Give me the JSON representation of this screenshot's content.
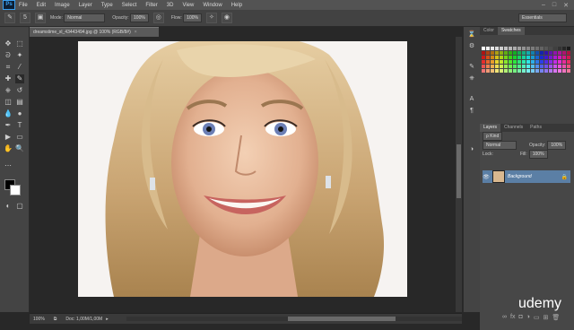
{
  "app": {
    "logo": "Ps"
  },
  "menu": [
    "File",
    "Edit",
    "Image",
    "Layer",
    "Type",
    "Select",
    "Filter",
    "3D",
    "View",
    "Window",
    "Help"
  ],
  "window_controls": [
    "–",
    "□",
    "✕"
  ],
  "options_bar": {
    "brush_size": "5",
    "mode_label": "Mode:",
    "mode_value": "Normal",
    "opacity_label": "Opacity:",
    "opacity_value": "100%",
    "flow_label": "Flow:",
    "flow_value": "100%",
    "workspace": "Essentials"
  },
  "document": {
    "tab_title": "dreamstime_xl_43443494.jpg @ 100% (RGB/8#)",
    "close": "×",
    "zoom": "100%",
    "doc_size": "Doc: 1,00M/1,00M"
  },
  "right_panel": {
    "color_tabs": [
      "Color",
      "Swatches"
    ],
    "layers_tabs": [
      "Layers",
      "Channels",
      "Paths"
    ],
    "kind_label": "ρ Kind",
    "blend_mode": "Normal",
    "opacity_label": "Opacity:",
    "opacity_value": "100%",
    "lock_label": "Lock:",
    "fill_label": "Fill:",
    "fill_value": "100%",
    "layer_name": "Background"
  },
  "watermark": "udemy",
  "colors": {
    "fg": "#000000",
    "bg": "#ffffff",
    "layer_selected": "#5b7fa5"
  }
}
